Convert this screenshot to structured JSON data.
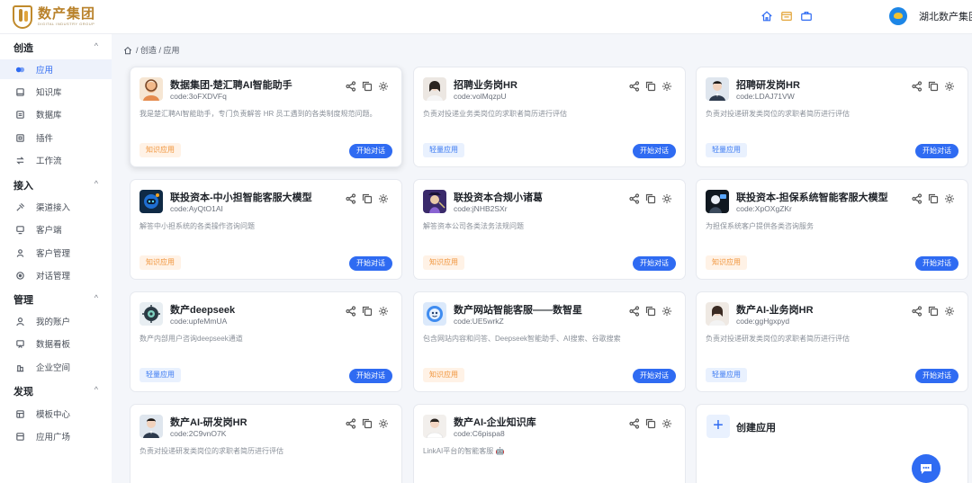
{
  "brand": {
    "name_cn": "数产集团",
    "name_en": "DIGITAL INDUSTRY GROUP"
  },
  "header": {
    "org_name": "湖北数产集团"
  },
  "sidebar": {
    "groups": [
      {
        "label": "创造",
        "items": [
          {
            "label": "应用",
            "icon": "app-icon",
            "active": true
          },
          {
            "label": "知识库",
            "icon": "knowledge-icon"
          },
          {
            "label": "数据库",
            "icon": "database-icon"
          },
          {
            "label": "插件",
            "icon": "plugin-icon"
          },
          {
            "label": "工作流",
            "icon": "workflow-icon"
          }
        ]
      },
      {
        "label": "接入",
        "items": [
          {
            "label": "渠道接入",
            "icon": "channel-icon"
          },
          {
            "label": "客户端",
            "icon": "client-icon"
          },
          {
            "label": "客户管理",
            "icon": "customer-icon"
          },
          {
            "label": "对话管理",
            "icon": "conversation-icon"
          }
        ]
      },
      {
        "label": "管理",
        "items": [
          {
            "label": "我的账户",
            "icon": "account-icon"
          },
          {
            "label": "数据看板",
            "icon": "dashboard-icon"
          },
          {
            "label": "企业空间",
            "icon": "enterprise-icon"
          }
        ]
      },
      {
        "label": "发现",
        "items": [
          {
            "label": "模板中心",
            "icon": "template-icon"
          },
          {
            "label": "应用广场",
            "icon": "square-icon"
          }
        ]
      }
    ]
  },
  "breadcrumb": {
    "text": "/ 创造 / 应用"
  },
  "create_card": {
    "label": "创建应用"
  },
  "start_label": "开始对话",
  "cards": [
    {
      "title": "数据集团-楚汇聘AI智能助手",
      "code": "code:3oFXDVFq",
      "desc": "我是楚汇聘AI智能助手，专门负责解答 HR 员工遇到的各类制度规范问题。",
      "tag": "知识应用",
      "tag_color": "orange",
      "icon": "assistant-avatar-icon",
      "highlight": true
    },
    {
      "title": "招聘业务岗HR",
      "code": "code:volMqzpU",
      "desc": "负责对投递业务类岗位的求职者简历进行评估",
      "tag": "轻量应用",
      "tag_color": "blue",
      "icon": "hr-woman-avatar-icon"
    },
    {
      "title": "招聘研发岗HR",
      "code": "code:LDAJ71VW",
      "desc": "负责对投递研发类岗位的求职者简历进行评估",
      "tag": "轻量应用",
      "tag_color": "blue",
      "icon": "hr-man-avatar-icon"
    },
    {
      "title": "联投资本-中小担智能客服大模型",
      "code": "code:AyQtO1AI",
      "desc": "解答中小担系统的各类操作咨询问题",
      "tag": "知识应用",
      "tag_color": "orange",
      "icon": "robot-avatar-icon"
    },
    {
      "title": "联投资本合规小诸葛",
      "code": "code:jNHB2SXr",
      "desc": "解答资本公司各类法务法规问题",
      "tag": "知识应用",
      "tag_color": "orange",
      "icon": "sage-avatar-icon"
    },
    {
      "title": "联投资本-担保系统智能客服大模型",
      "code": "code:XpOXgZKr",
      "desc": "为担保系统客户提供各类咨询服务",
      "tag": "知识应用",
      "tag_color": "orange",
      "icon": "robot-dark-avatar-icon"
    },
    {
      "title": "数产deepseek",
      "code": "code:upfeMmUA",
      "desc": "数产内部用户咨询deepseek通道",
      "tag": "轻量应用",
      "tag_color": "blue",
      "icon": "deepseek-avatar-icon"
    },
    {
      "title": "数产网站智能客服——数智星",
      "code": "code:UE5wrkZ",
      "desc": "包含网站内容和问答、Deepseek智能助手、AI搜索、谷歌搜索",
      "tag": "知识应用",
      "tag_color": "orange",
      "icon": "star-avatar-icon"
    },
    {
      "title": "数产AI-业务岗HR",
      "code": "code:ggHgxpyd",
      "desc": "负责对投递研发类岗位的求职者简历进行评估",
      "tag": "轻量应用",
      "tag_color": "blue",
      "icon": "hr-woman-avatar-icon"
    },
    {
      "title": "数产AI-研发岗HR",
      "code": "code:2C9vnO7K",
      "desc": "负责对投递研发类岗位的求职者简历进行评估",
      "tag": "",
      "tag_color": "blue",
      "icon": "hr-man-avatar-icon"
    },
    {
      "title": "数产AI-企业知识库",
      "code": "code:C6pispa8",
      "desc": "LinkAI平台的智能客服 🤖",
      "tag": "",
      "tag_color": "blue",
      "icon": "hr-woman-avatar-icon"
    }
  ],
  "colors": {
    "accent": "#2f6bf2",
    "brand_gold": "#b9822b",
    "tag_orange": "#f0953c",
    "tag_blue": "#3d7bf2"
  }
}
